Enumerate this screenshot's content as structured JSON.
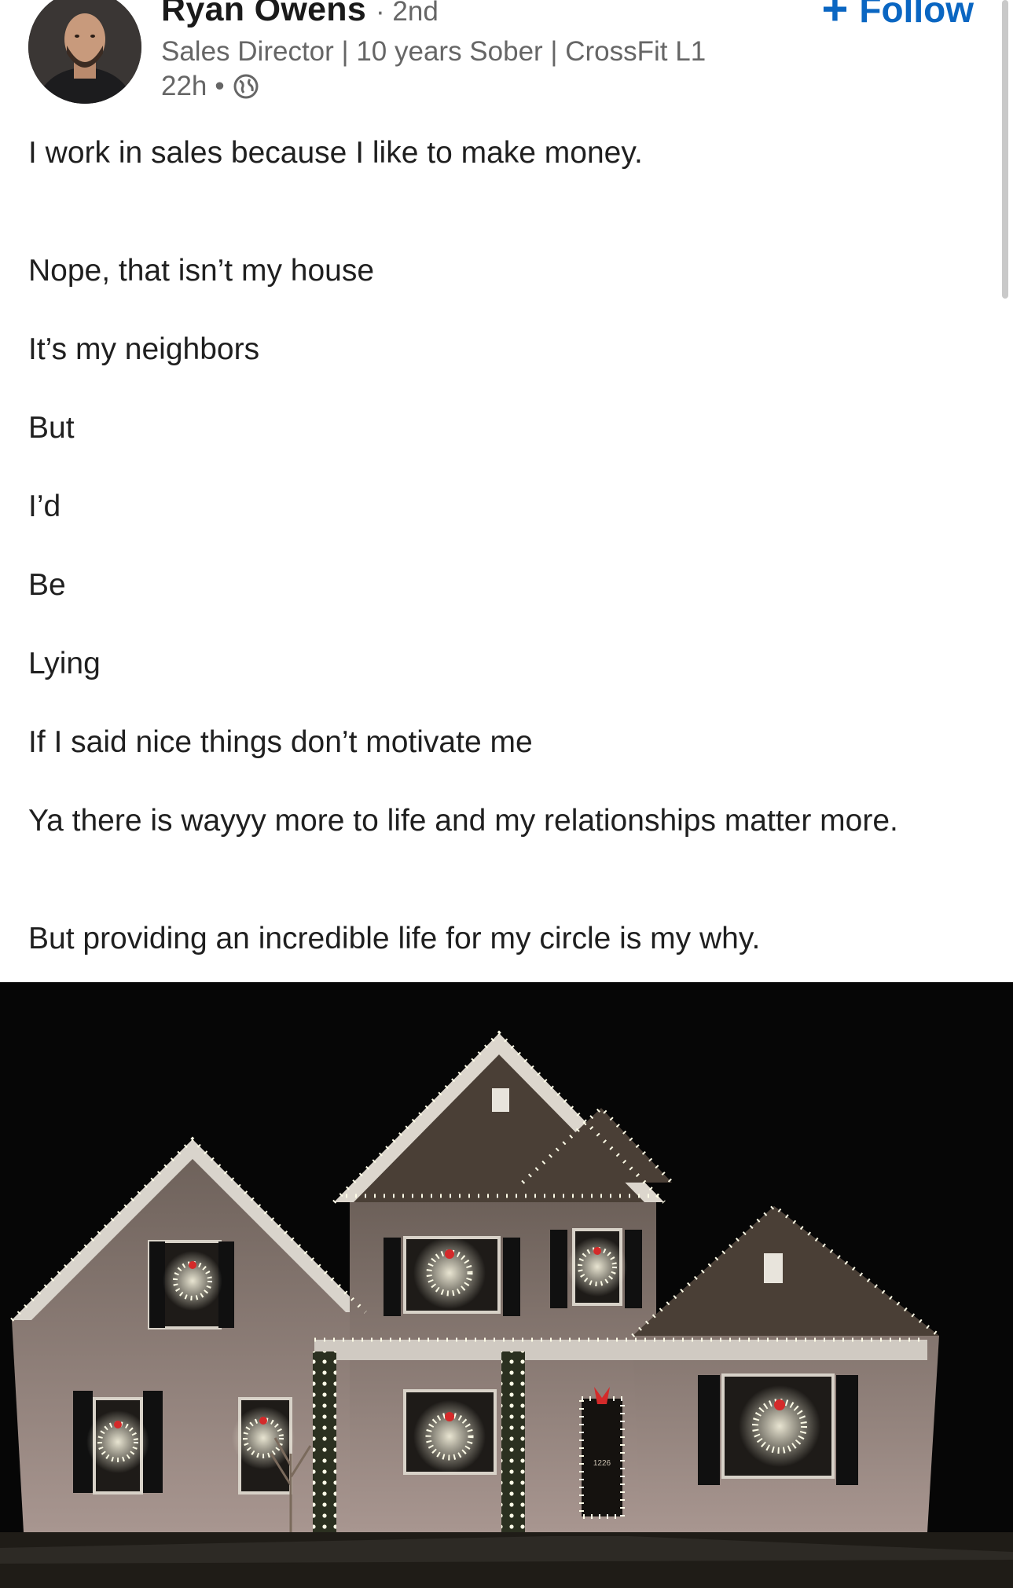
{
  "author": {
    "name": "Ryan Owens",
    "degree": "· 2nd",
    "headline": "Sales Director | 10 years Sober | CrossFit L1",
    "time": "22h",
    "separator": "•"
  },
  "follow": {
    "label": "Follow"
  },
  "icons": {
    "avatar": "profile-photo",
    "visibility": "globe-icon",
    "follow": "plus-icon"
  },
  "colors": {
    "accent": "#0a66c2",
    "muted": "#666666",
    "text": "#1f1f1f"
  },
  "post": {
    "paragraphs": [
      "I work in sales because I like to make money.",
      "Nope, that isn’t my house",
      "It’s my neighbors",
      "But",
      "I’d",
      "Be",
      "Lying",
      "If I said nice things don’t motivate me",
      "Ya there is wayyy more to life and my relationships matter more.",
      "But providing an incredible life for my circle is my why."
    ]
  },
  "image": {
    "house_number": "1226"
  }
}
